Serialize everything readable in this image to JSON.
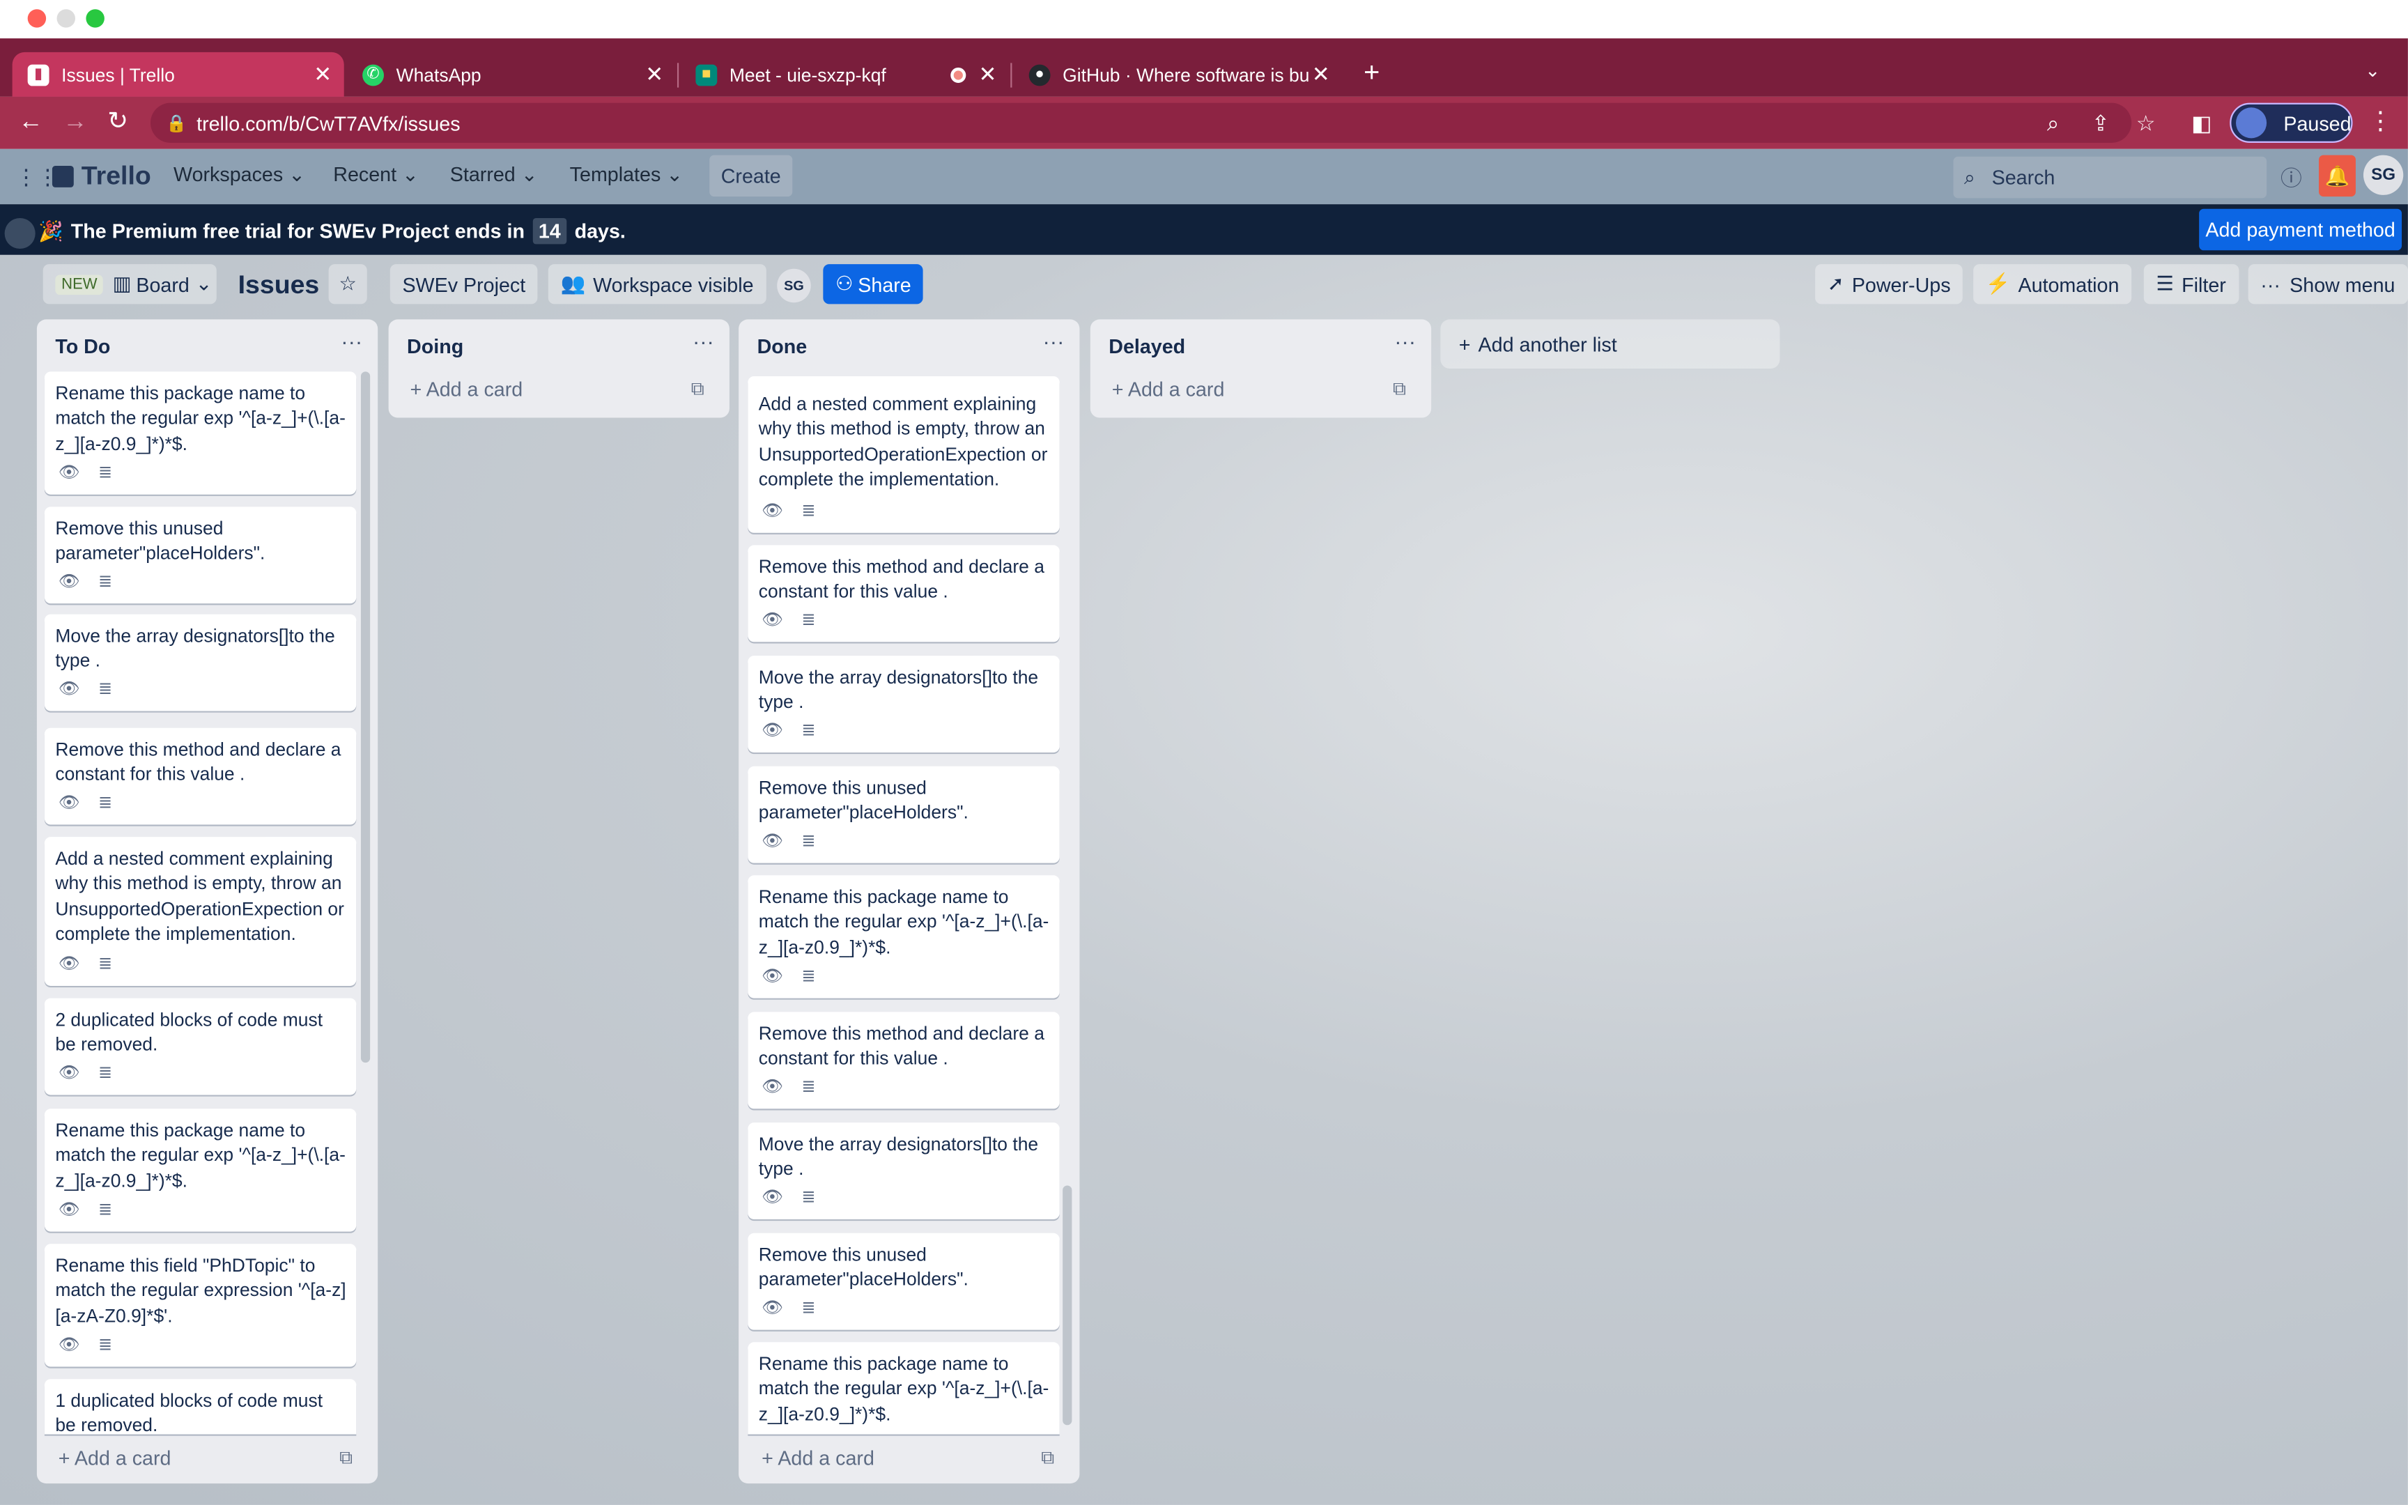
{
  "browser": {
    "tabs": [
      {
        "title": "Issues | Trello"
      },
      {
        "title": "WhatsApp"
      },
      {
        "title": "Meet - uie-sxzp-kqf"
      },
      {
        "title": "GitHub · Where software is buil"
      }
    ],
    "url": "trello.com/b/CwT7AVfx/issues",
    "profile_label": "Paused",
    "accent_color": "#7a1e3c"
  },
  "trello": {
    "logo": "Trello",
    "nav": {
      "workspaces": "Workspaces",
      "recent": "Recent",
      "starred": "Starred",
      "templates": "Templates",
      "create": "Create"
    },
    "search_placeholder": "Search",
    "avatar": "SG"
  },
  "banner": {
    "text_before": "The Premium free trial for SWEv Project ends in",
    "days": "14",
    "text_after": "days.",
    "button": "Add payment method"
  },
  "boardbar": {
    "new_badge": "NEW",
    "view": "Board",
    "title": "Issues",
    "workspace": "SWEv Project",
    "visibility": "Workspace visible",
    "member": "SG",
    "share": "Share",
    "powerups": "Power-Ups",
    "automation": "Automation",
    "filter": "Filter",
    "show_menu": "Show menu"
  },
  "lists": {
    "todo": {
      "title": "To Do",
      "add_card": "Add a card",
      "cards": [
        "Rename this package name to match the regular exp '^[a-z_]+(\\.[a-z_][a-z0.9_]*)*$.",
        "Remove this unused parameter\"placeHolders\".",
        "Move the array designators[]to the type .",
        "Remove this method and declare a constant for this value .",
        "Add a nested comment explaining why this method is empty, throw an UnsupportedOperationExpection or complete the implementation.",
        "2 duplicated blocks of code must be removed.",
        "Rename this package name to match the regular exp '^[a-z_]+(\\.[a-z_][a-z0.9_]*)*$.",
        "Rename this field \"PhDTopic\" to match the regular expression '^[a-z][a-zA-Z0.9]*$'.",
        "1 duplicated blocks of code must be removed."
      ]
    },
    "doing": {
      "title": "Doing",
      "add_card": "Add a card"
    },
    "done": {
      "title": "Done",
      "add_card": "Add a card",
      "cards": [
        "Add a nested comment explaining why this method is empty, throw an UnsupportedOperationExpection or complete the implementation.",
        "Remove this method and declare a constant for this value .",
        "Move the array designators[]to the type .",
        "Remove this unused parameter\"placeHolders\".",
        "Rename this package name to match the regular exp '^[a-z_]+(\\.[a-z_][a-z0.9_]*)*$.",
        "Remove this method and declare a constant for this value .",
        "Move the array designators[]to the type .",
        "Remove this unused parameter\"placeHolders\".",
        "Rename this package name to match the regular exp '^[a-z_]+(\\.[a-z_][a-z0.9_]*)*$."
      ]
    },
    "delayed": {
      "title": "Delayed",
      "add_card": "Add a card"
    },
    "add_list": "Add another list"
  }
}
